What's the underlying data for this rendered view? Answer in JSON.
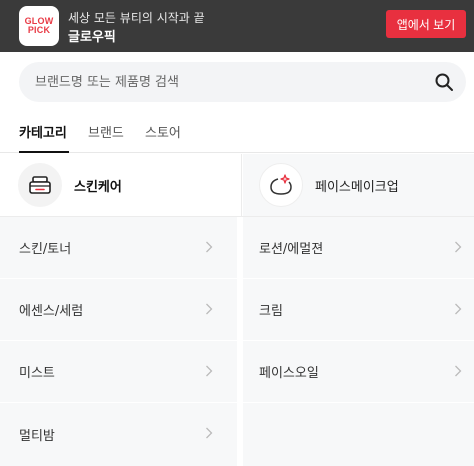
{
  "banner": {
    "logo_line1": "GLOW",
    "logo_line2": "PICK",
    "subtitle": "세상 모든 뷰티의 시작과 끝",
    "title": "글로우픽",
    "app_button": "앱에서 보기",
    "brand_color": "#e8303f"
  },
  "search": {
    "placeholder": "브랜드명 또는 제품명 검색",
    "icon": "search-icon"
  },
  "tabs": [
    {
      "label": "카테고리",
      "active": true
    },
    {
      "label": "브랜드",
      "active": false
    },
    {
      "label": "스토어",
      "active": false
    }
  ],
  "categories": [
    {
      "label": "스킨케어",
      "icon": "cream-jar-icon",
      "selected": true
    },
    {
      "label": "페이스메이크업",
      "icon": "compact-sparkle-icon",
      "selected": false
    }
  ],
  "subcategories": [
    {
      "label": "스킨/토너"
    },
    {
      "label": "로션/에멀젼"
    },
    {
      "label": "에센스/세럼"
    },
    {
      "label": "크림"
    },
    {
      "label": "미스트"
    },
    {
      "label": "페이스오일"
    },
    {
      "label": "멀티밤"
    }
  ]
}
